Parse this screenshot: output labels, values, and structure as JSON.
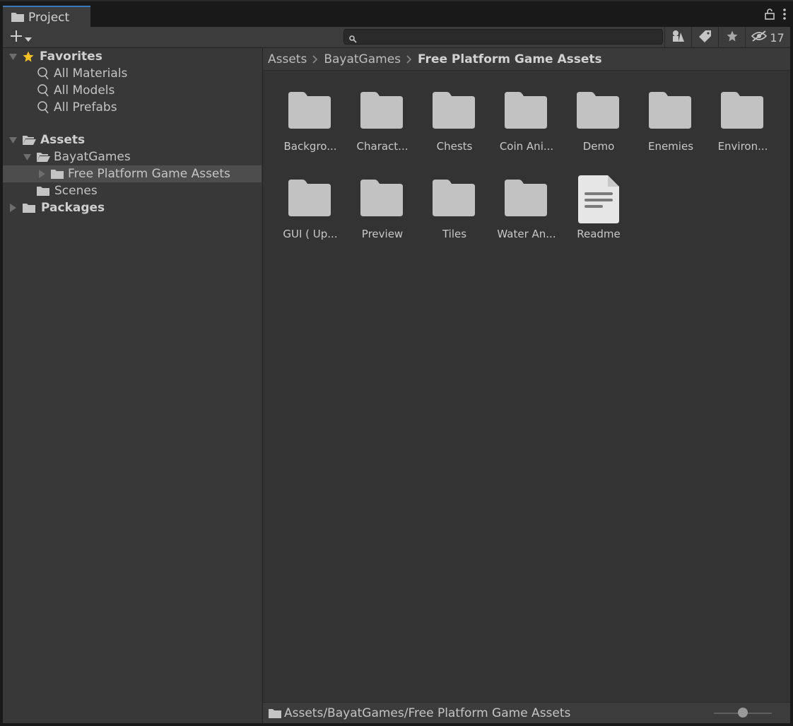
{
  "window": {
    "tab_label": "Project",
    "hidden_count": "17"
  },
  "search": {
    "placeholder": ""
  },
  "tree": {
    "favorites_label": "Favorites",
    "favorites": [
      "All Materials",
      "All Models",
      "All Prefabs"
    ],
    "assets_label": "Assets",
    "bayat_label": "BayatGames",
    "free_platform_label": "Free Platform Game Assets",
    "scenes_label": "Scenes",
    "packages_label": "Packages"
  },
  "breadcrumb": {
    "items": [
      "Assets",
      "BayatGames",
      "Free Platform Game Assets"
    ]
  },
  "items": [
    {
      "name": "Backgro...",
      "type": "folder"
    },
    {
      "name": "Charact...",
      "type": "folder"
    },
    {
      "name": "Chests",
      "type": "folder"
    },
    {
      "name": "Coin Ani...",
      "type": "folder"
    },
    {
      "name": "Demo",
      "type": "folder"
    },
    {
      "name": "Enemies",
      "type": "folder"
    },
    {
      "name": "Environ...",
      "type": "folder"
    },
    {
      "name": "GUI ( Up...",
      "type": "folder"
    },
    {
      "name": "Preview",
      "type": "folder"
    },
    {
      "name": "Tiles",
      "type": "folder"
    },
    {
      "name": "Water An...",
      "type": "folder"
    },
    {
      "name": "Readme",
      "type": "text-asset"
    }
  ],
  "status": {
    "path": "Assets/BayatGames/Free Platform Game Assets",
    "zoom_fraction": 0.5
  },
  "colors": {
    "accent": "#3a79bb",
    "folder": "#c2c2c2",
    "star": "#f4c321"
  }
}
